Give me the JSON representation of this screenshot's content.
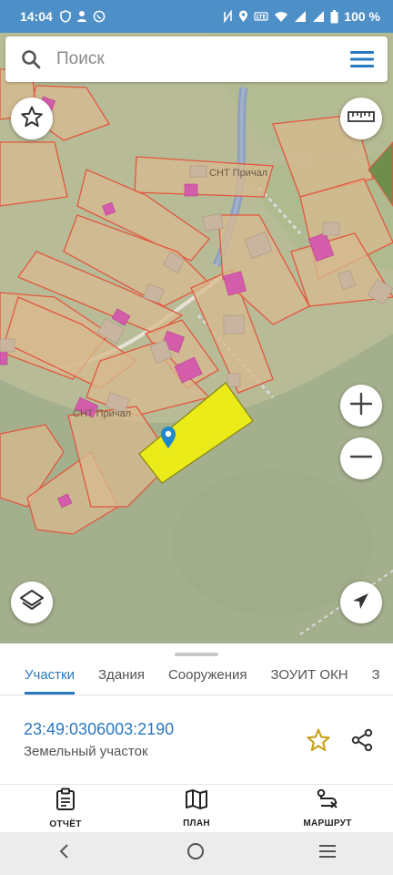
{
  "status_bar": {
    "time": "14:04",
    "battery": "100 %",
    "left_icons": [
      "shield-icon",
      "person-icon",
      "whatsapp-icon"
    ],
    "right_icons": [
      "nfc-icon",
      "location-icon",
      "volte-icon",
      "wifi-icon",
      "signal-icon",
      "signal-icon",
      "battery-icon"
    ]
  },
  "search": {
    "placeholder": "Поиск"
  },
  "map": {
    "labels": {
      "snt_top": "СНТ Причал",
      "snt_mid": "СНТ Причал"
    },
    "colors": {
      "parcel_fill": "#d8b98f",
      "parcel_stroke": "#e55a4a",
      "building": "#d85fb0",
      "selected": "#ebeb1a",
      "marker": "#1e88c8"
    }
  },
  "tabs": [
    {
      "label": "Участки",
      "active": true
    },
    {
      "label": "Здания",
      "active": false
    },
    {
      "label": "Сооружения",
      "active": false
    },
    {
      "label": "ЗОУИТ ОКН",
      "active": false
    },
    {
      "label": "З",
      "active": false
    }
  ],
  "parcel": {
    "number": "23:49:0306003:2190",
    "type": "Земельный участок"
  },
  "bottom_nav": [
    {
      "label": "ОТЧЁТ",
      "icon": "clipboard-icon"
    },
    {
      "label": "ПЛАН",
      "icon": "map-icon"
    },
    {
      "label": "МАРШРУТ",
      "icon": "route-icon"
    }
  ]
}
